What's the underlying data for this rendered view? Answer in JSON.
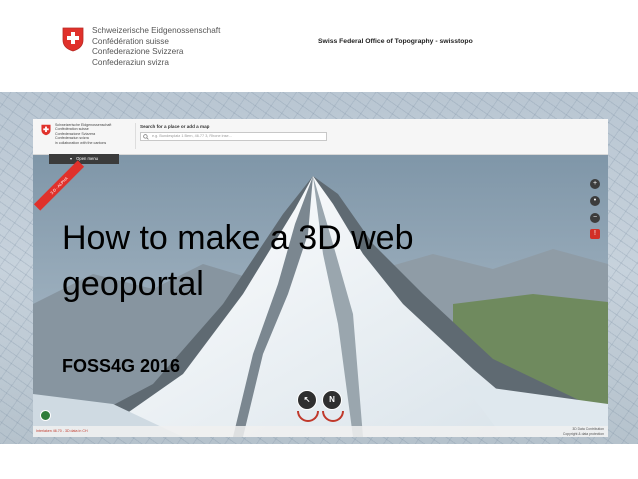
{
  "header": {
    "confederation_names": [
      "Schweizerische Eidgenossenschaft",
      "Confédération suisse",
      "Confederazione Svizzera",
      "Confederaziun svizra"
    ],
    "office": "Swiss Federal Office of Topography - swisstopo"
  },
  "geoportal": {
    "names": [
      "Schweizerische Eidgenossenschaft",
      "Confédération suisse",
      "Confederazione Svizzera",
      "Confederaziun svizra"
    ],
    "names_extra": "in collaboration with the cantons",
    "search_label": "Search for a place or add a map",
    "search_placeholder": "e.g. Bundesplatz 1 Bern, 46.77 3, Rhone inse...",
    "open_menu": "Open menu",
    "ribbon": "3-D - ALPHA",
    "compass_left": "↖",
    "compass_right": "N",
    "status_left": "Interlaken 46.70 - 3D data in CH",
    "status_right_1": "3D Data Contribution",
    "status_right_2": "Copyright & data protection",
    "icons": [
      "zoom-in",
      "zoom-out",
      "rotate",
      "report-problem"
    ]
  },
  "slide": {
    "title": "How to make a 3D web geoportal",
    "subtitle": "FOSS4G 2016"
  },
  "colors": {
    "swiss_red": "#e0312b",
    "menu_dark": "#3b3b3b",
    "snow": "#eef3f7",
    "rock": "#5f6a72"
  }
}
